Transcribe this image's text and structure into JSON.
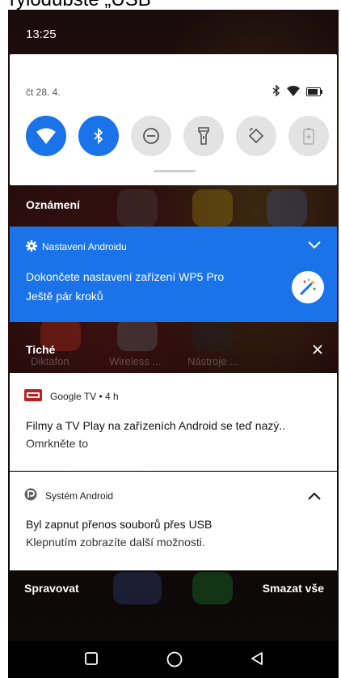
{
  "caption": {
    "text": "rylodubste „USB ”"
  },
  "status_bar": {
    "time": "13:25"
  },
  "quick_settings": {
    "date": "čt 28. 4.",
    "status_icons": [
      "bluetooth-icon",
      "wifi-signal-icon",
      "battery-icon"
    ],
    "tiles": [
      {
        "icon": "wifi-icon",
        "active": true
      },
      {
        "icon": "bluetooth-icon",
        "active": true
      },
      {
        "icon": "do-not-disturb-icon",
        "active": false
      },
      {
        "icon": "flashlight-icon",
        "active": false
      },
      {
        "icon": "auto-rotate-icon",
        "active": false
      },
      {
        "icon": "battery-saver-icon",
        "active": false
      }
    ]
  },
  "sections": {
    "notifications_label": "Oznámení",
    "silent_label": "Tiché"
  },
  "setup_notification": {
    "app_name": "Nastavení Androidu",
    "title": "Dokončete nastavení zařízení WP5 Pro",
    "subtitle": "Ještě pár kroků"
  },
  "notifications": [
    {
      "app_name": "Google TV",
      "time": " • 4 h",
      "title": "Filmy a TV Play na zařízeních Android se teď nazý..",
      "text": "Omrkněte to"
    },
    {
      "app_name": "Systém Android",
      "title": "Byl zapnut přenos souborů přes USB",
      "text": "Klepnutím zobrazíte další možnosti."
    }
  ],
  "footer": {
    "manage_label": "Spravovat",
    "clear_all_label": "Smazat vše"
  },
  "background_apps": [
    "Diktafon",
    "Wireless ...",
    "Nástroje ..."
  ],
  "colors": {
    "accent": "#1a73e8",
    "tile_off": "#e3e3e3",
    "google_tv": "#b3261e"
  }
}
